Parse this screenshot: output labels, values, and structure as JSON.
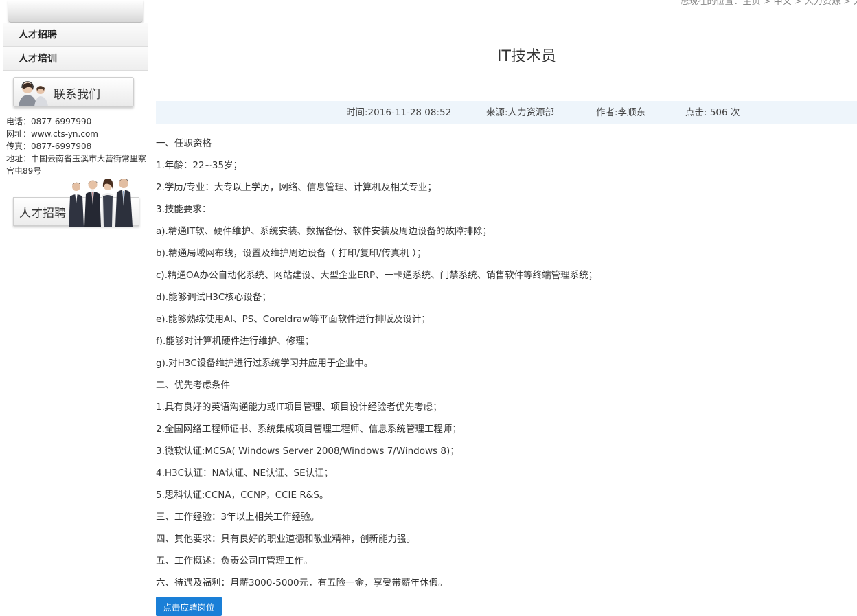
{
  "breadcrumb": "您现在的位置：主页 > 中文 > 人力资源 > 人",
  "sidebar": {
    "menu": [
      "人才招聘",
      "人才培训"
    ],
    "contact_title": "联系我们",
    "phone": "电话：0877-6997990",
    "website": "网址：www.cts-yn.com",
    "fax": "传真：0877-6997908",
    "address": "地址：中国云南省玉溪市大营街常里察官屯89号",
    "recruit_banner": "人才招聘"
  },
  "article": {
    "title": "IT技术员",
    "time": "时间:2016-11-28 08:52",
    "source": "来源:人力资源部",
    "author": "作者:李顺东",
    "clicks": "点击: 506 次",
    "lines": [
      "一、任职资格",
      "1.年龄：22~35岁；",
      "2.学历/专业：大专以上学历，网络、信息管理、计算机及相关专业；",
      "3.技能要求：",
      "a).精通IT软、硬件维护、系统安装、数据备份、软件安装及周边设备的故障排除；",
      "b).精通局域网布线，设置及维护周边设备（ 打印/复印/传真机 ）；",
      "c).精通OA办公自动化系统、网站建设、大型企业ERP、一卡通系统、门禁系统、销售软件等终端管理系统；",
      "d).能够调试H3C核心设备；",
      "e).能够熟练使用AI、PS、Coreldraw等平面软件进行排版及设计；",
      "f).能够对计算机硬件进行维护、修理；",
      "g).对H3C设备维护进行过系统学习并应用于企业中。",
      "二、优先考虑条件",
      "1.具有良好的英语沟通能力或IT项目管理、项目设计经验者优先考虑；",
      "2.全国网络工程师证书、系统集成项目管理工程师、信息系统管理工程师；",
      "3.微软认证:MCSA( Windows Server 2008/Windows 7/Windows 8)；",
      "4.H3C认证：NA认证、NE认证、SE认证；",
      "5.思科认证:CCNA，CCNP，CCIE R&S。",
      "三、工作经验：3年以上相关工作经验。",
      "四、其他要求：具有良好的职业道德和敬业精神，创新能力强。",
      "五、工作概述：负责公司IT管理工作。",
      "六、待遇及福利：月薪3000-5000元，有五险一金，享受带薪年休假。"
    ],
    "apply_label": "点击应聘岗位"
  },
  "icons": {
    "contact": "headset-operator-icon",
    "recruit": "business-people-icon"
  }
}
